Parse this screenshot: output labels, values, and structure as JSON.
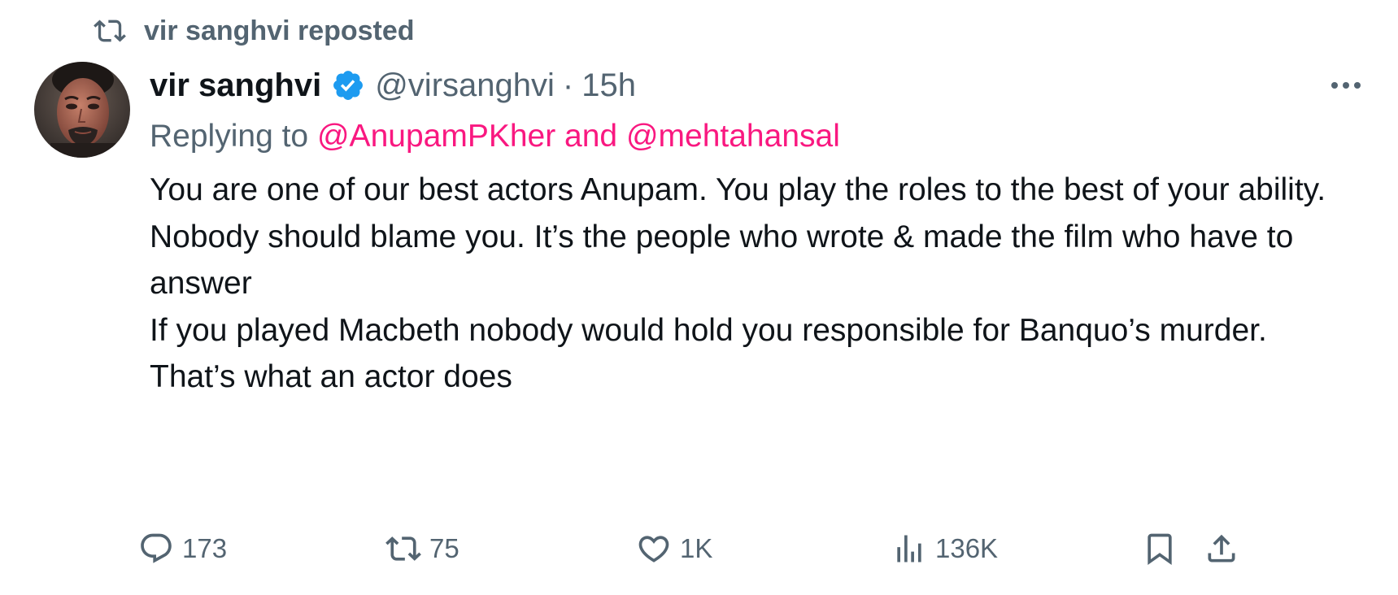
{
  "repost": {
    "label": "vir sanghvi reposted",
    "icon": "repost-icon"
  },
  "author": {
    "display_name": "vir sanghvi",
    "handle": "@virsanghvi",
    "separator": "·",
    "time": "15h",
    "verified_icon": "verified-badge-icon",
    "verified_color": "#1d9bf0"
  },
  "replying": {
    "prefix": "Replying to",
    "mentions": "@AnupamPKher and @mehtahansal",
    "mention_color": "#f91880"
  },
  "tweet": {
    "lines": [
      "You are one of our best actors Anupam. You play the roles to the best of your ability.",
      "Nobody should blame you. It’s the people who wrote & made the film who have to answer",
      "If you played Macbeth nobody would hold you responsible for Banquo’s murder.",
      "That’s what an actor does"
    ]
  },
  "actions": {
    "replies": "173",
    "reposts": "75",
    "likes": "1K",
    "views": "136K"
  },
  "colors": {
    "text": "#0f1419",
    "secondary": "#536471",
    "accent": "#f91880"
  }
}
